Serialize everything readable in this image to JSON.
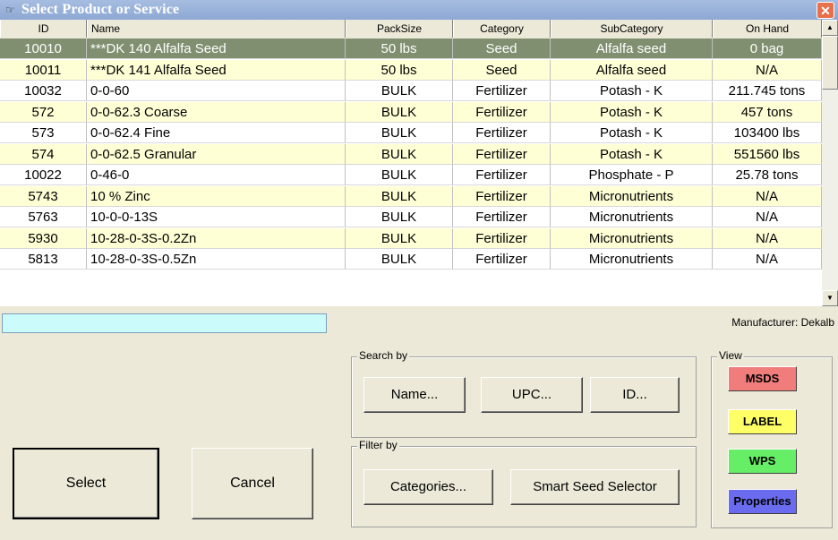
{
  "window": {
    "title": "Select Product or Service",
    "icon": "pointing-hand-icon"
  },
  "columns": [
    "ID",
    "Name",
    "PackSize",
    "Category",
    "SubCategory",
    "On Hand"
  ],
  "rows": [
    {
      "id": "10010",
      "name": "***DK 140 Alfalfa Seed",
      "pack": "50 lbs",
      "cat": "Seed",
      "sub": "Alfalfa seed",
      "onhand": "0 bag",
      "selected": true
    },
    {
      "id": "10011",
      "name": "***DK 141 Alfalfa Seed",
      "pack": "50 lbs",
      "cat": "Seed",
      "sub": "Alfalfa seed",
      "onhand": "N/A"
    },
    {
      "id": "10032",
      "name": "0-0-60",
      "pack": "BULK",
      "cat": "Fertilizer",
      "sub": "Potash - K",
      "onhand": "211.745 tons"
    },
    {
      "id": "572",
      "name": "0-0-62.3 Coarse",
      "pack": "BULK",
      "cat": "Fertilizer",
      "sub": "Potash - K",
      "onhand": "457 tons"
    },
    {
      "id": "573",
      "name": "0-0-62.4 Fine",
      "pack": "BULK",
      "cat": "Fertilizer",
      "sub": "Potash - K",
      "onhand": "103400 lbs"
    },
    {
      "id": "574",
      "name": "0-0-62.5 Granular",
      "pack": "BULK",
      "cat": "Fertilizer",
      "sub": "Potash - K",
      "onhand": "551560 lbs"
    },
    {
      "id": "10022",
      "name": "0-46-0",
      "pack": "BULK",
      "cat": "Fertilizer",
      "sub": "Phosphate - P",
      "onhand": "25.78 tons"
    },
    {
      "id": "5743",
      "name": "10 % Zinc",
      "pack": "BULK",
      "cat": "Fertilizer",
      "sub": "Micronutrients",
      "onhand": "N/A"
    },
    {
      "id": "5763",
      "name": "10-0-0-13S",
      "pack": "BULK",
      "cat": "Fertilizer",
      "sub": "Micronutrients",
      "onhand": "N/A"
    },
    {
      "id": "5930",
      "name": "10-28-0-3S-0.2Zn",
      "pack": "BULK",
      "cat": "Fertilizer",
      "sub": "Micronutrients",
      "onhand": "N/A"
    },
    {
      "id": "5813",
      "name": "10-28-0-3S-0.5Zn",
      "pack": "BULK",
      "cat": "Fertilizer",
      "sub": "Micronutrients",
      "onhand": "N/A"
    }
  ],
  "filter": {
    "value": ""
  },
  "manufacturer": "Manufacturer: Dekalb",
  "search_by": {
    "label": "Search by",
    "buttons": [
      "Name...",
      "UPC...",
      "ID..."
    ]
  },
  "filter_by": {
    "label": "Filter by",
    "buttons": [
      "Categories...",
      "Smart Seed Selector"
    ]
  },
  "view": {
    "label": "View",
    "buttons": [
      {
        "label": "MSDS",
        "color": "#f07c7c"
      },
      {
        "label": "LABEL",
        "color": "#ffff66"
      },
      {
        "label": "WPS",
        "color": "#66ee66"
      },
      {
        "label": "Properties",
        "color": "#6b6bf0"
      }
    ]
  },
  "actions": {
    "select": "Select",
    "cancel": "Cancel"
  },
  "colors": {
    "row_alt": "#ffffd6",
    "row_selected": "#808f70",
    "cyan_field": "#ccfbfb"
  }
}
